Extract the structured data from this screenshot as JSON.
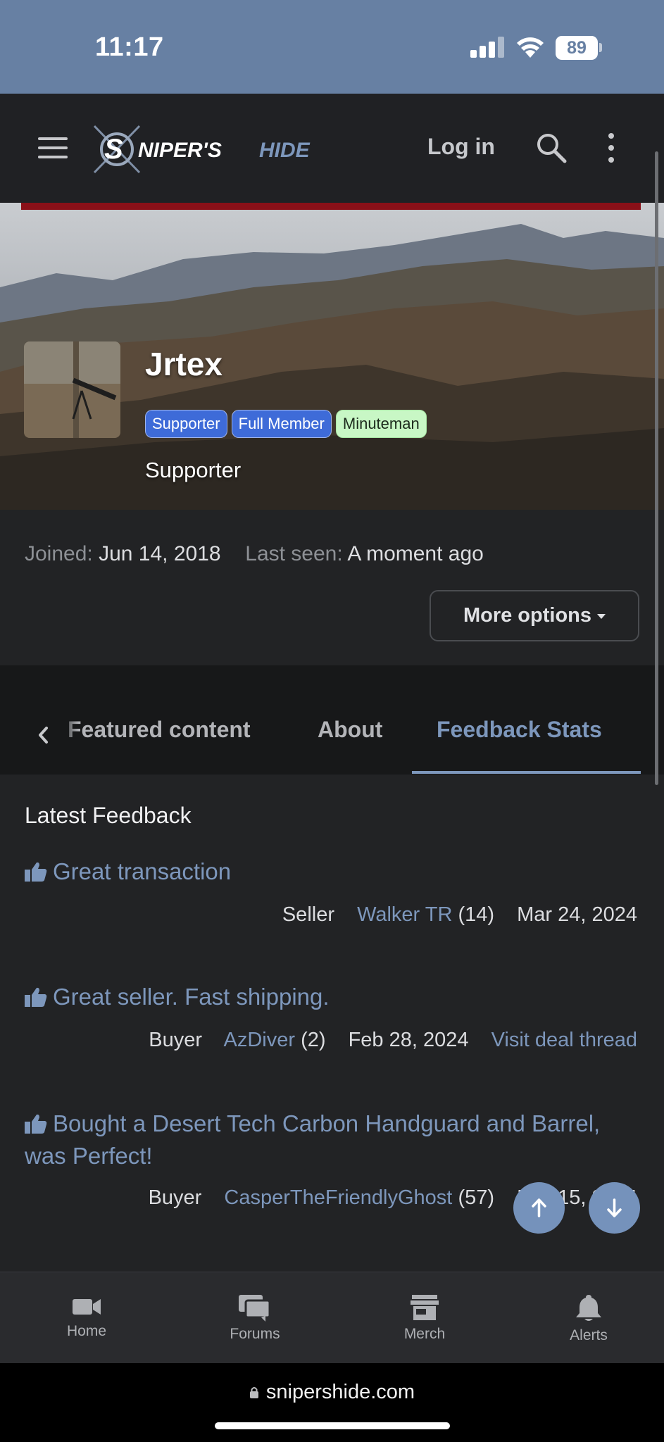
{
  "status_bar": {
    "time": "11:17",
    "battery": "89"
  },
  "header": {
    "brand": "SNIPER'S HIDE",
    "login_label": "Log in"
  },
  "profile": {
    "username": "Jrtex",
    "badges": [
      "Supporter",
      "Full Member",
      "Minuteman"
    ],
    "user_title": "Supporter",
    "joined_label": "Joined:",
    "joined_value": "Jun 14, 2018",
    "last_seen_label": "Last seen:",
    "last_seen_value": "A moment ago",
    "more_options_label": "More options"
  },
  "tabs": {
    "items": [
      {
        "label": "Featured content"
      },
      {
        "label": "About"
      },
      {
        "label": "Feedback Stats"
      }
    ],
    "active": "Feedback Stats"
  },
  "feedback": {
    "title": "Latest Feedback",
    "entries": [
      {
        "text": "Great transaction",
        "role": "Seller",
        "user": "Walker TR",
        "count": "(14)",
        "date": "Mar 24, 2024",
        "deal_link": ""
      },
      {
        "text": "Great seller. Fast shipping.",
        "role": "Buyer",
        "user": "AzDiver",
        "count": "(2)",
        "date": "Feb 28, 2024",
        "deal_link": "Visit deal thread"
      },
      {
        "text": "Bought a Desert Tech Carbon Handguard and Barrel, was Perfect!",
        "role": "Buyer",
        "user": "CasperTheFriendlyGhost",
        "count": "(57)",
        "date": "Feb 15, 2024",
        "deal_link": ""
      }
    ]
  },
  "bottom_nav": {
    "items": [
      {
        "label": "Home",
        "icon": "video-camera-icon"
      },
      {
        "label": "Forums",
        "icon": "chat-bubbles-icon"
      },
      {
        "label": "Merch",
        "icon": "store-icon"
      },
      {
        "label": "Alerts",
        "icon": "bell-icon"
      }
    ]
  },
  "url_bar": {
    "url": "snipershide.com"
  },
  "colors": {
    "accent": "#7d97bc",
    "status_bar": "#6780a3",
    "badge_blue": "#3e6bd8",
    "badge_green": "#c8f7c5"
  }
}
